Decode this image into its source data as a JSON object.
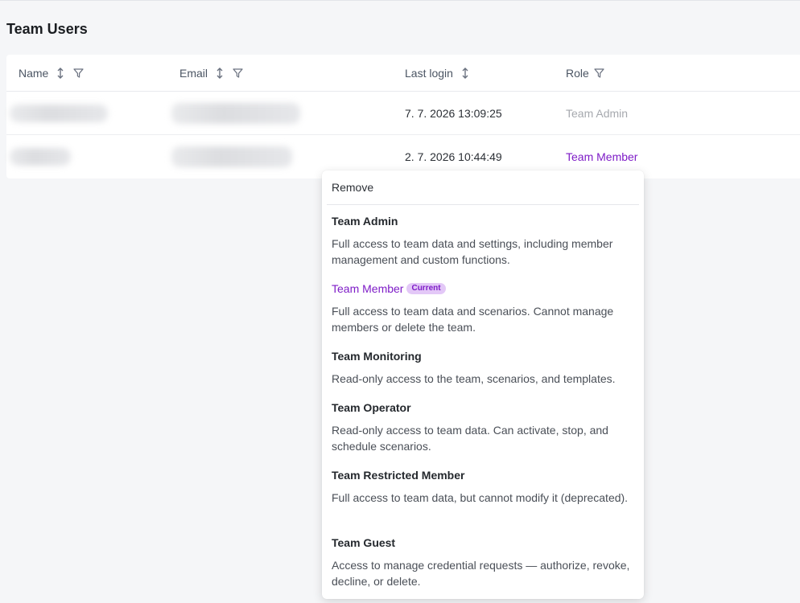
{
  "page": {
    "title": "Team Users"
  },
  "table": {
    "columns": {
      "name": "Name",
      "email": "Email",
      "last_login": "Last login",
      "role": "Role"
    },
    "rows": [
      {
        "last_login": "7. 7. 2026 13:09:25",
        "role": "Team Admin"
      },
      {
        "last_login": "2. 7. 2026 10:44:49",
        "role": "Team Member"
      }
    ]
  },
  "role_menu": {
    "remove_label": "Remove",
    "current_badge": "Current",
    "options": [
      {
        "title": "Team Admin",
        "description": "Full access to team data and settings, including member management and custom functions."
      },
      {
        "title": "Team Member",
        "description": "Full access to team data and scenarios. Cannot manage members or delete the team.",
        "current": true
      },
      {
        "title": "Team Monitoring",
        "description": "Read-only access to the team, scenarios, and templates."
      },
      {
        "title": "Team Operator",
        "description": "Read-only access to team data. Can activate, stop, and schedule scenarios."
      },
      {
        "title": "Team Restricted Member",
        "description": "Full access to team data, but cannot modify it (deprecated)."
      },
      {
        "title": "Team Guest",
        "description": "Access to manage credential requests — authorize, revoke, decline, or delete."
      }
    ]
  },
  "icons": {
    "sort": "sort-arrows-icon",
    "filter": "filter-funnel-icon"
  },
  "colors": {
    "accent": "#7e1cc7",
    "badge_bg": "#e3c8f7",
    "muted_role": "#a6a9ae"
  }
}
